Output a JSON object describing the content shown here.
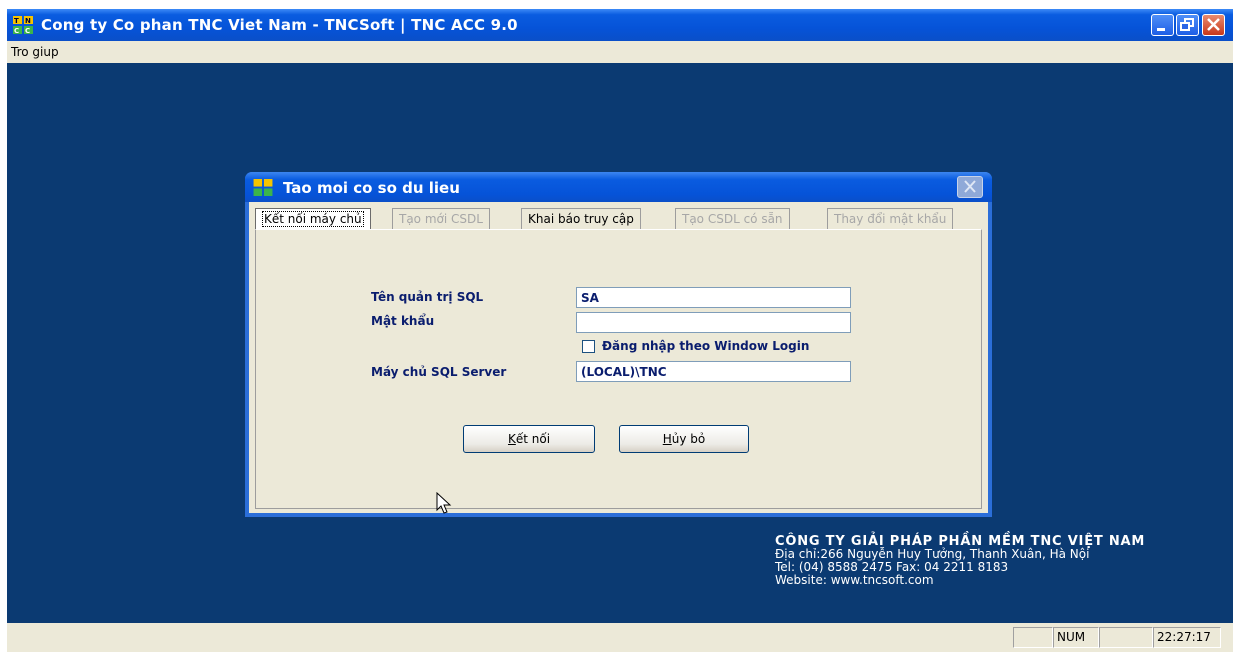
{
  "window": {
    "title": "Cong ty Co phan TNC Viet Nam - TNCSoft  |  TNC ACC 9.0",
    "icon": "tnc-logo-icon"
  },
  "menubar": {
    "items": [
      "Tro giup"
    ]
  },
  "dialog": {
    "title": "Tao moi co so du lieu",
    "tabs": [
      {
        "label": "Kết nối máy chủ",
        "state": "active"
      },
      {
        "label": "Tạo mới CSDL",
        "state": "disabled"
      },
      {
        "label": "Khai báo truy cập",
        "state": "enabled"
      },
      {
        "label": "Tạo CSDL có sẵn",
        "state": "disabled"
      },
      {
        "label": "Thay đổi mật khẩu",
        "state": "disabled"
      }
    ],
    "form": {
      "sql_admin_label": "Tên quản trị SQL",
      "sql_admin_value": "SA",
      "password_label": "Mật khẩu",
      "password_value": "",
      "windows_login_label": "Đăng nhập theo Window Login",
      "windows_login_checked": false,
      "server_label": "Máy chủ SQL Server",
      "server_value": "(LOCAL)\\TNC"
    },
    "buttons": {
      "connect_hotkey": "K",
      "connect_rest": "ết nối",
      "cancel_hotkey": "H",
      "cancel_rest": "ủy bỏ"
    }
  },
  "company": {
    "name": "CÔNG TY GIẢI PHÁP PHẦN MỀM TNC VIỆT NAM",
    "address": "Địa chỉ:266 Nguyễn Huy Tưởng, Thanh Xuân, Hà Nội",
    "phone": "Tel: (04) 8588 2475 Fax: 04 2211 8183",
    "website": "Website: www.tncsoft.com"
  },
  "statusbar": {
    "num": "NUM",
    "time": "22:27:17"
  },
  "colors": {
    "desktop": "#0b3a72",
    "titlebar": "#0653d8",
    "label": "#0a1d6e"
  }
}
